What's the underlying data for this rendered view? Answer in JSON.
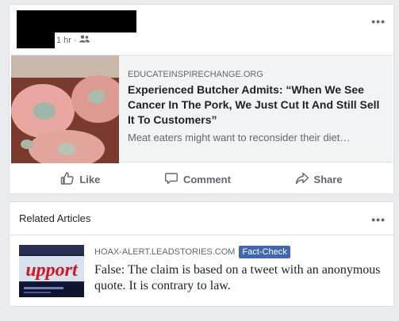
{
  "post": {
    "timestamp": "1 hr",
    "separator": "·",
    "audience_icon": "friends-icon",
    "more_label": "•••",
    "link": {
      "domain": "EDUCATEINSPIRECHANGE.ORG",
      "headline": "Experienced Butcher Admits: “When We See Cancer In The Pork, We Just Cut It And Still Sell It To Customers”",
      "description": "Meat eaters might want to reconsider their diet…"
    },
    "actions": [
      {
        "label": "Like",
        "icon": "thumbs-up-icon"
      },
      {
        "label": "Comment",
        "icon": "comment-icon"
      },
      {
        "label": "Share",
        "icon": "share-icon"
      }
    ]
  },
  "related": {
    "title": "Related Articles",
    "more_label": "•••",
    "item": {
      "domain": "HOAX-ALERT.LEADSTORIES.COM",
      "badge": "Fact-Check",
      "text": "False: The claim is based on a tweet with an anonymous quote. It is contrary to law.",
      "thumb_text": "upport"
    }
  },
  "colors": {
    "background": "#e9ebee",
    "badge": "#4267b2",
    "muted": "#606770",
    "redaction": "#000000"
  }
}
